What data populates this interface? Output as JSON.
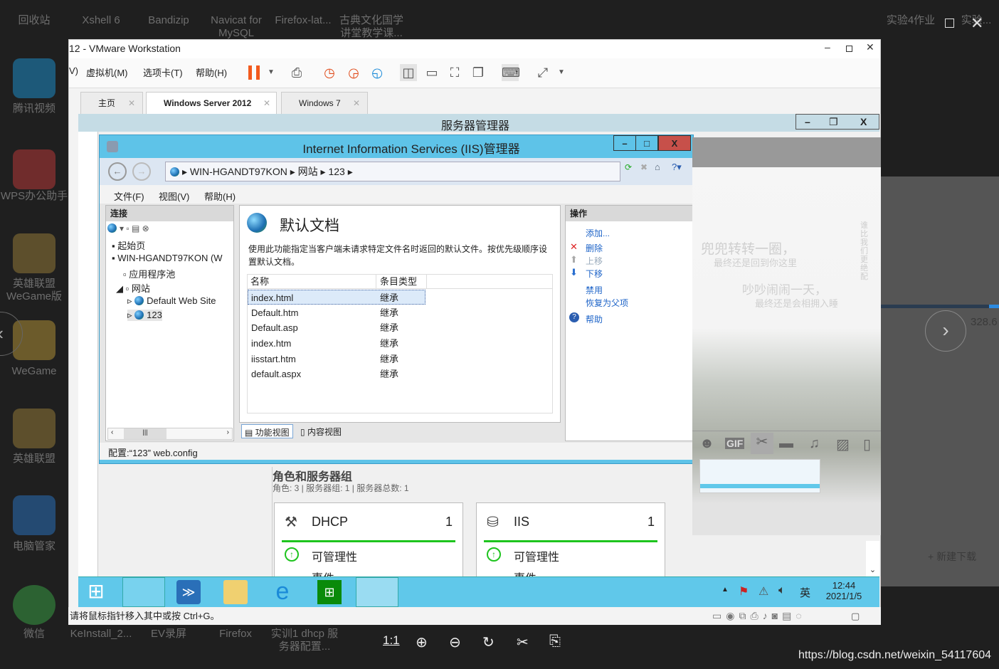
{
  "desktop": {
    "top_icons": [
      "回收站",
      "Xshell 6",
      "Bandizip",
      "Navicat for MySQL",
      "Firefox-lat...",
      "古典文化国学讲堂教学课..."
    ],
    "top_right_icons": [
      "实验4作业",
      "实验..."
    ],
    "left_icons": [
      "腾讯视频",
      "WPS办公助手",
      "英雄联盟WeGame版",
      "WeGame",
      "英雄联盟",
      "电脑管家",
      "微信"
    ],
    "bottom_icons": [
      "KeInstall_2...",
      "EV录屏",
      "Firefox",
      "实训1 dhcp 服务器配置..."
    ],
    "right_panel_value": "328.6",
    "right_panel_action": "+ 新建下载",
    "watermark": "https://blog.csdn.net/weixin_54117604"
  },
  "viewer_toolbar": {
    "actual_size": "1:1",
    "icons": [
      "zoom-in-icon",
      "zoom-out-icon",
      "rotate-icon",
      "crop-icon",
      "save-icon"
    ]
  },
  "vmware": {
    "title": "12 - VMware Workstation",
    "menus": [
      "V)",
      "虚拟机(M)",
      "选项卡(T)",
      "帮助(H)"
    ],
    "tabs": [
      "主页",
      "Windows Server 2012",
      "Windows 7"
    ],
    "status": "请将鼠标指针移入其中或按 Ctrl+G。"
  },
  "server_manager": {
    "title": "服务器管理器",
    "section_title": "角色和服务器组",
    "section_sub": "角色: 3 | 服务器组: 1 | 服务器总数: 1",
    "cards": [
      {
        "name": "DHCP",
        "count": "1",
        "status": "可管理性",
        "next": "事件"
      },
      {
        "name": "IIS",
        "count": "1",
        "status": "可管理性",
        "next": "事件"
      }
    ]
  },
  "iis": {
    "title": "Internet Information Services (IIS)管理器",
    "breadcrumb": [
      "WIN-HGANDT97KON",
      "网站",
      "123"
    ],
    "menus": [
      "文件(F)",
      "视图(V)",
      "帮助(H)"
    ],
    "connections_header": "连接",
    "tree": [
      "起始页",
      "WIN-HGANDT97KON (W",
      "应用程序池",
      "网站",
      "Default Web Site",
      "123"
    ],
    "feature_title": "默认文档",
    "description": "使用此功能指定当客户端未请求特定文件名时返回的默认文件。按优先级顺序设置默认文档。",
    "columns": [
      "名称",
      "条目类型"
    ],
    "rows": [
      [
        "index.html",
        "继承"
      ],
      [
        "Default.htm",
        "继承"
      ],
      [
        "Default.asp",
        "继承"
      ],
      [
        "index.htm",
        "继承"
      ],
      [
        "iisstart.htm",
        "继承"
      ],
      [
        "default.aspx",
        "继承"
      ]
    ],
    "views": [
      "功能视图",
      "内容视图"
    ],
    "actions_header": "操作",
    "actions": [
      "添加...",
      "删除",
      "上移",
      "下移",
      "禁用",
      "恢复为父项",
      "帮助"
    ],
    "statusbar": "配置:“123” web.config"
  },
  "taskbar": {
    "time": "12:44",
    "date": "2021/1/5",
    "ime": "英"
  },
  "chat_overlay": {
    "line1": "兜兜转转一圈，",
    "line2": "最终还是回到你这里",
    "line3": "吵吵闹闹一天，",
    "line4": "最终还是会相拥入睡",
    "side": "谁比我们更绝配",
    "toolbar": [
      "emoji-icon",
      "gif-icon",
      "scissors-icon",
      "folder-icon",
      "music-icon",
      "image-icon",
      "phone-icon"
    ]
  }
}
